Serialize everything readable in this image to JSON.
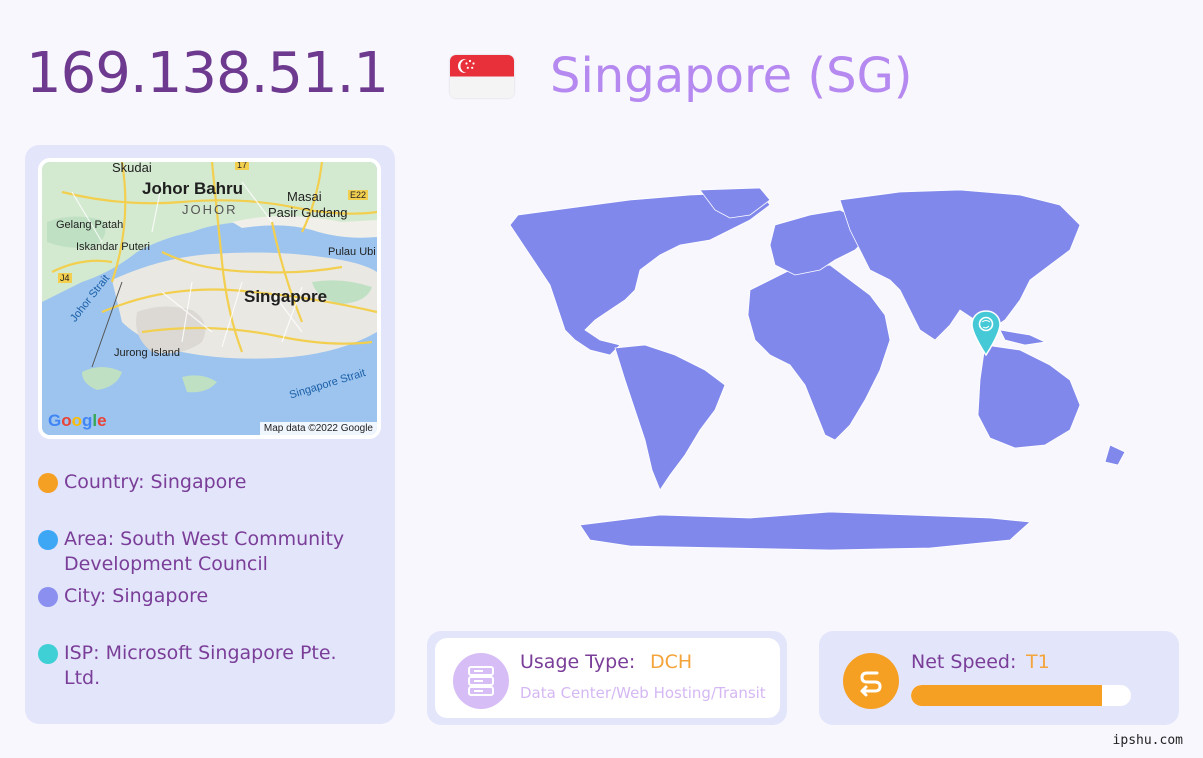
{
  "header": {
    "ip": "169.138.51.1",
    "country_title": "Singapore (SG)"
  },
  "map": {
    "labels": {
      "skudai": "Skudai",
      "johor_bahru": "Johor Bahru",
      "johor": "JOHOR",
      "masai": "Masai",
      "pasir_gudang": "Pasir Gudang",
      "gelang_patah": "Gelang Patah",
      "iskandar_puteri": "Iskandar Puteri",
      "pulau_ubin": "Pulau Ubi",
      "singapore": "Singapore",
      "johor_strait": "Johor Strait",
      "jurong_island": "Jurong Island",
      "singapore_strait": "Singapore Strait",
      "road_17": "17",
      "road_e22": "E22",
      "road_j4": "J4"
    },
    "google_logo": "Google",
    "attribution": "Map data ©2022 Google"
  },
  "info": {
    "country": "Country: Singapore",
    "area": "Area: South West Community Development Council",
    "city": "City: Singapore",
    "isp": "ISP: Microsoft Singapore Pte. Ltd."
  },
  "usage": {
    "label": "Usage Type:",
    "value": "DCH",
    "description": "Data Center/Web Hosting/Transit"
  },
  "speed": {
    "label": "Net Speed:",
    "value": "T1",
    "level_percent": 87
  },
  "watermark": "ipshu.com",
  "colors": {
    "country_dot": "#f6a023",
    "area_dot": "#3ea7f5",
    "city_dot": "#8b8fef",
    "isp_dot": "#3fd0d6",
    "map_land": "#8188ec",
    "pin": "#46c9d6"
  }
}
